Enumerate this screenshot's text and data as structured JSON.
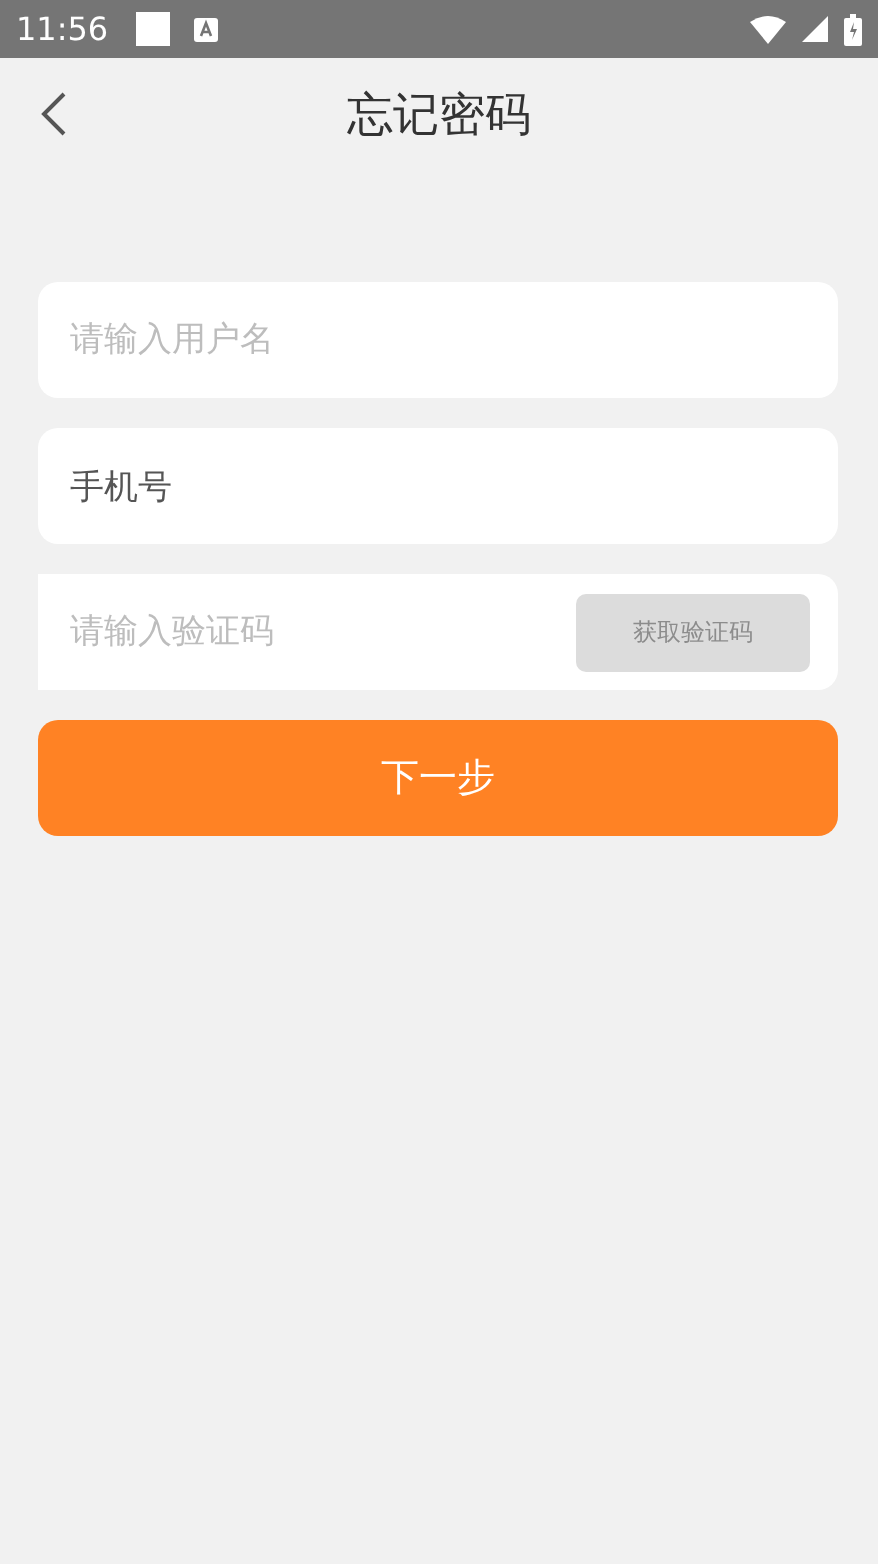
{
  "status_bar": {
    "time": "11:56"
  },
  "header": {
    "title": "忘记密码"
  },
  "fields": [
    {
      "kind": "input",
      "placeholder": "请输入用户名"
    },
    {
      "kind": "input",
      "value": "手机号"
    },
    {
      "kind": "code",
      "placeholder": "请输入验证码",
      "button": "获取验证码",
      "disabled": true
    }
  ],
  "submit": {
    "label": "下一步"
  }
}
